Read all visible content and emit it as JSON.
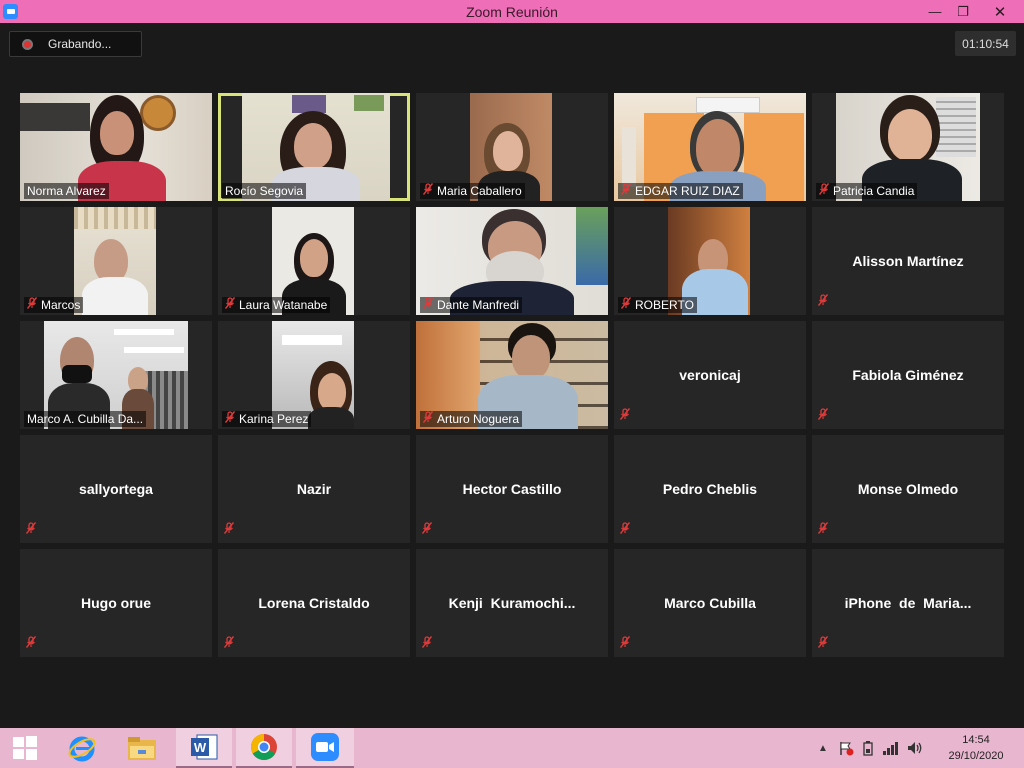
{
  "window": {
    "title": "Zoom Reunión",
    "minimize": "—",
    "maximize": "❐",
    "close": "✕"
  },
  "recording": {
    "label": "Grabando..."
  },
  "timer": "01:10:54",
  "participants": [
    {
      "name": "Norma Alvarez",
      "muted": false,
      "video": true
    },
    {
      "name": "Rocío Segovia",
      "muted": false,
      "video": true,
      "active": true
    },
    {
      "name": "Maria Caballero",
      "muted": true,
      "video": true
    },
    {
      "name": "EDGAR RUIZ DIAZ",
      "muted": true,
      "video": true
    },
    {
      "name": "Patricia Candia",
      "muted": true,
      "video": true
    },
    {
      "name": "Marcos",
      "muted": true,
      "video": true
    },
    {
      "name": "Laura Watanabe",
      "muted": true,
      "video": true
    },
    {
      "name": "Dante Manfredi",
      "muted": true,
      "video": true
    },
    {
      "name": "ROBERTO",
      "muted": true,
      "video": true
    },
    {
      "name": "Alisson Martínez",
      "muted": true,
      "video": false
    },
    {
      "name": "Marco A. Cubilla Da...",
      "muted": false,
      "video": true
    },
    {
      "name": "Karina Perez",
      "muted": true,
      "video": true
    },
    {
      "name": "Arturo Noguera",
      "muted": true,
      "video": true
    },
    {
      "name": "veronicaj",
      "muted": true,
      "video": false
    },
    {
      "name": "Fabiola Giménez",
      "muted": true,
      "video": false
    },
    {
      "name": "sallyortega",
      "muted": true,
      "video": false
    },
    {
      "name": "Nazir",
      "muted": true,
      "video": false
    },
    {
      "name": "Hector Castillo",
      "muted": true,
      "video": false
    },
    {
      "name": "Pedro Cheblis",
      "muted": true,
      "video": false
    },
    {
      "name": "Monse Olmedo",
      "muted": true,
      "video": false
    },
    {
      "name": "Hugo orue",
      "muted": true,
      "video": false
    },
    {
      "name": "Lorena Cristaldo",
      "muted": true,
      "video": false
    },
    {
      "name": "Kenji  Kuramochi...",
      "muted": true,
      "video": false
    },
    {
      "name": "Marco Cubilla",
      "muted": true,
      "video": false
    },
    {
      "name": "iPhone  de  Maria...",
      "muted": true,
      "video": false
    }
  ],
  "taskbar": {
    "apps": [
      "start-icon",
      "internet-explorer-icon",
      "file-explorer-icon",
      "word-icon",
      "chrome-icon",
      "zoom-icon"
    ],
    "time": "14:54",
    "date": "29/10/2020"
  },
  "colors": {
    "titlebar": "#ee6fb8",
    "taskbar": "#e9b6cf",
    "active_speaker": "#d8e37a",
    "muted_mic": "#e03a3a"
  }
}
